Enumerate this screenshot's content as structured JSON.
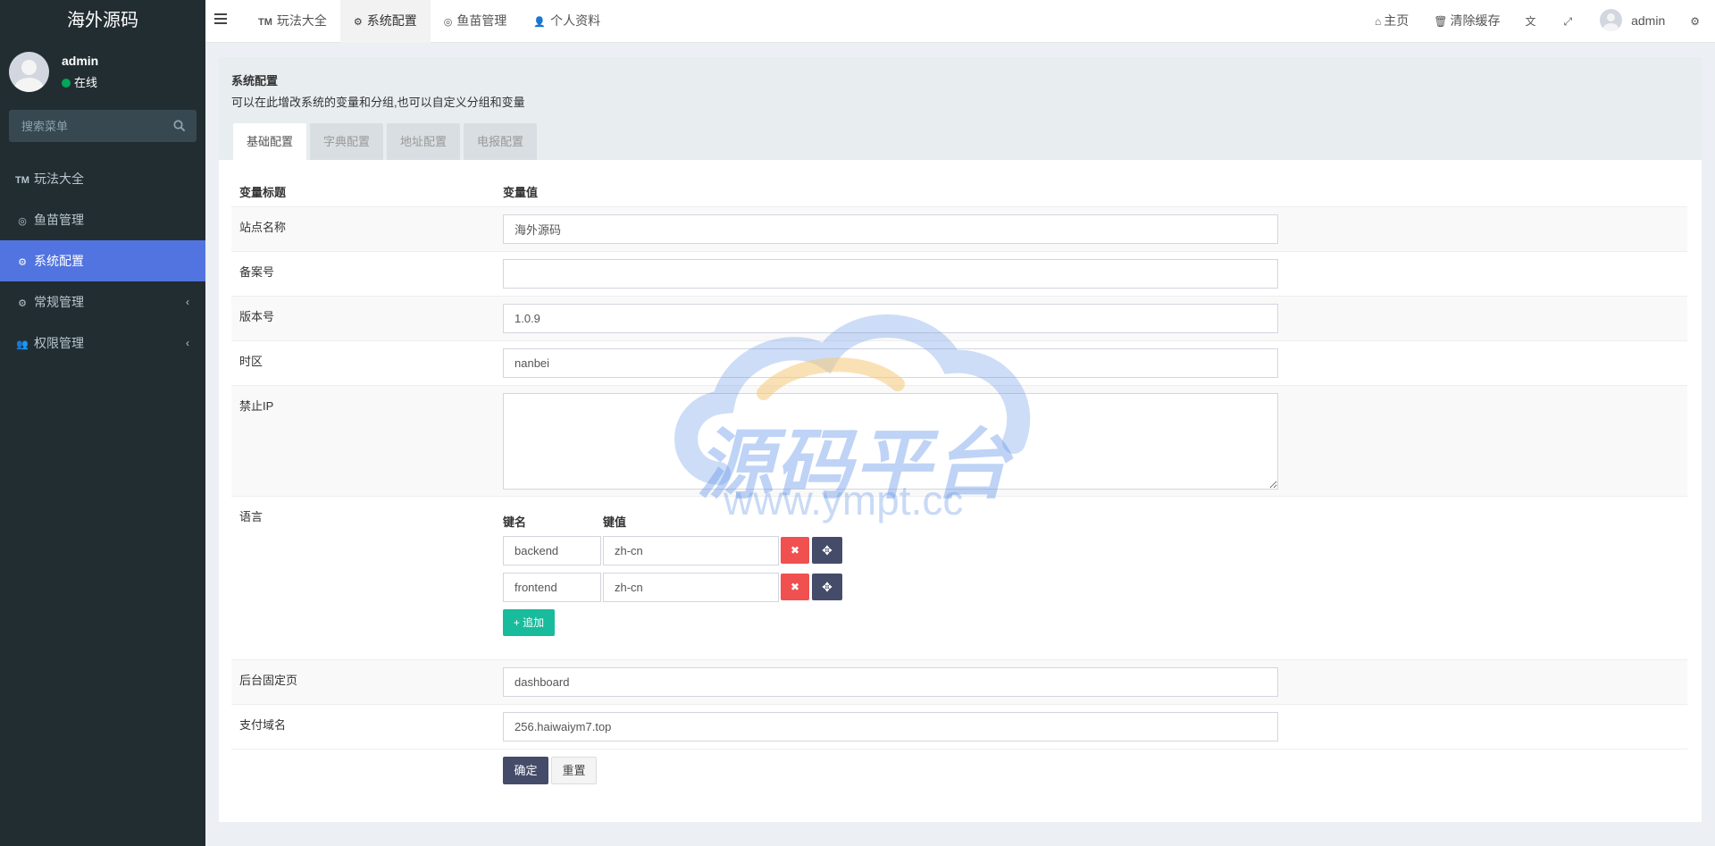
{
  "sidebar": {
    "brand": "海外源码",
    "user": {
      "name": "admin",
      "status": "在线"
    },
    "search_placeholder": "搜索菜单",
    "items": [
      {
        "icon": "tm-icon",
        "glyph": "TM",
        "label": "玩法大全"
      },
      {
        "icon": "eye-icon",
        "glyph": "◎",
        "label": "鱼苗管理"
      },
      {
        "icon": "gear-icon",
        "glyph": "⚙",
        "label": "系统配置",
        "active": true
      },
      {
        "icon": "cogs-icon",
        "glyph": "⚙",
        "label": "常规管理",
        "chevron": "‹"
      },
      {
        "icon": "users-icon",
        "glyph": "👥",
        "label": "权限管理",
        "chevron": "‹"
      }
    ]
  },
  "navbar": {
    "tabs": [
      {
        "glyph": "TM",
        "label": "玩法大全"
      },
      {
        "glyph": "⚙",
        "label": "系统配置",
        "active": true
      },
      {
        "glyph": "◎",
        "label": "鱼苗管理"
      },
      {
        "glyph": "👤",
        "label": "个人资料"
      }
    ],
    "right": {
      "home": "主页",
      "clear_cache": "清除缓存",
      "user": "admin"
    }
  },
  "page": {
    "title": "系统配置",
    "description": "可以在此增改系统的变量和分组,也可以自定义分组和变量",
    "tabs": [
      "基础配置",
      "字典配置",
      "地址配置",
      "电报配置"
    ],
    "active_tab": "基础配置"
  },
  "form": {
    "header": {
      "title": "变量标题",
      "value": "变量值"
    },
    "site_name": {
      "label": "站点名称",
      "value": "海外源码"
    },
    "beian": {
      "label": "备案号",
      "value": ""
    },
    "version": {
      "label": "版本号",
      "value": "1.0.9"
    },
    "timezone": {
      "label": "时区",
      "value": "nanbei"
    },
    "forbid_ip": {
      "label": "禁止IP",
      "value": ""
    },
    "language": {
      "label": "语言",
      "key_header": "键名",
      "value_header": "键值",
      "rows": [
        {
          "key": "backend",
          "value": "zh-cn"
        },
        {
          "key": "frontend",
          "value": "zh-cn"
        }
      ],
      "add_label": "+ 追加"
    },
    "fixed_page": {
      "label": "后台固定页",
      "value": "dashboard"
    },
    "pay_domain": {
      "label": "支付域名",
      "value": "256.haiwaiym7.top"
    },
    "submit_label": "确定",
    "reset_label": "重置"
  },
  "watermark": {
    "text": "源码平台",
    "url": "www.ympt.cc"
  }
}
